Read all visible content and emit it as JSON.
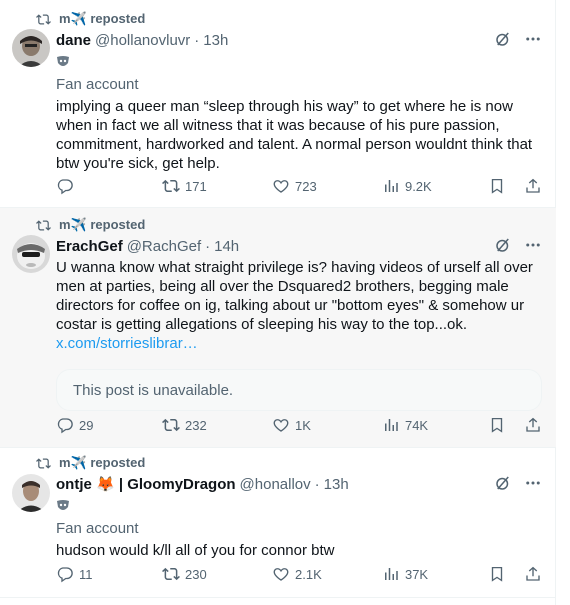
{
  "posts": [
    {
      "repost_label": "m✈️ reposted",
      "name": "dane",
      "handle": "@hollanovluvr",
      "time": "13h",
      "fan_label": "Fan account",
      "text": "implying a queer man “sleep through his way” to get where he is now when in fact we all witness that it was because of his pure passion, commitment, hardworked and talent. A normal person wouldnt think that btw you're sick, get help.",
      "reply_count": "",
      "repost_count": "171",
      "like_count": "723",
      "view_count": "9.2K"
    },
    {
      "repost_label": "m✈️ reposted",
      "name": "ErachGef",
      "handle": "@RachGef",
      "time": "14h",
      "text": "U wanna know what straight privilege is? having videos of urself all over men at parties, being all over the Dsquared2 brothers, begging male directors for coffee on ig, talking about ur \"bottom eyes\" & somehow ur costar is getting allegations of sleeping his way to the top...ok.",
      "link": "x.com/storrieslibrar…",
      "quote_unavailable": "This post is unavailable.",
      "reply_count": "29",
      "repost_count": "232",
      "like_count": "1K",
      "view_count": "74K"
    },
    {
      "repost_label": "m✈️ reposted",
      "name": "ontje 🦊 | GloomyDragon",
      "handle": "@honallov",
      "time": "13h",
      "fan_label": "Fan account",
      "text": "hudson would k/ll all of you for connor btw",
      "reply_count": "11",
      "repost_count": "230",
      "like_count": "2.1K",
      "view_count": "37K"
    }
  ],
  "icons": {
    "repost": "repost-icon",
    "grok": "grok-icon",
    "more": "more-icon",
    "reply": "reply-icon",
    "like": "like-icon",
    "views": "views-icon",
    "bookmark": "bookmark-icon",
    "share": "share-icon",
    "badge": "mask-badge-icon"
  },
  "colors": {
    "text": "#0f1419",
    "secondary": "#536471",
    "link": "#1d9bf0",
    "hover_bg": "#f7f7f7",
    "border": "#eff3f4"
  }
}
